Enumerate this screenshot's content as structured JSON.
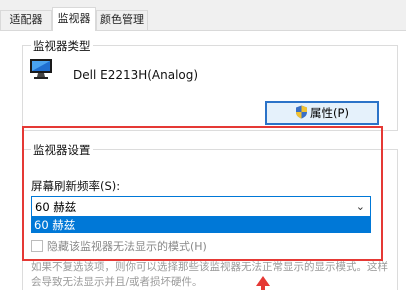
{
  "tabs": [
    {
      "label": "适配器"
    },
    {
      "label": "监视器"
    },
    {
      "label": "颜色管理"
    }
  ],
  "monitor_type": {
    "title": "监视器类型",
    "monitor_name": "Dell E2213H(Analog)",
    "properties_button": "属性(P)"
  },
  "monitor_settings": {
    "title": "监视器设置",
    "refresh_label": "屏幕刷新频率(S):",
    "selected_rate": "60 赫兹",
    "dropdown_options": [
      "60 赫兹"
    ],
    "hide_modes_label": "隐藏该监视器无法显示的模式(H)",
    "hide_modes_checked": false,
    "description": "如果不复选该项，则你可以选择那些该监视器无法正常显示的显示模式。这样会导致无法显示并且/或者损坏硬件。"
  },
  "colors": {
    "accent": "#0078d7",
    "highlight": "#e53935",
    "button_border": "#2b73c8"
  },
  "icons": {
    "monitor": "monitor-icon",
    "shield": "shield-icon",
    "dropdown": "chevron-down-icon",
    "annotation_arrow": "red-arrow-icon"
  }
}
